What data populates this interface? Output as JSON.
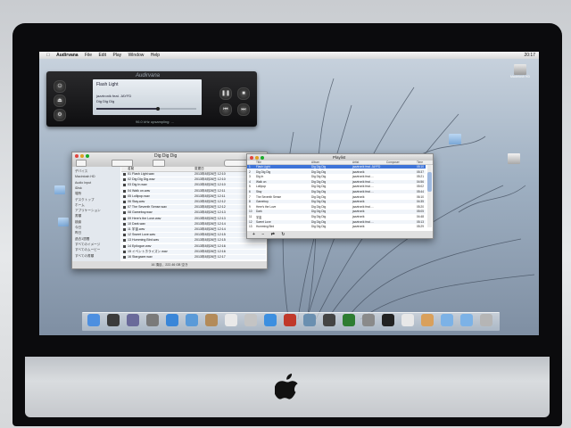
{
  "menubar": {
    "apple": "",
    "app_name": "Audirvana",
    "items": [
      "File",
      "Edit",
      "Play",
      "Window",
      "Help"
    ],
    "clock": "20:17"
  },
  "player": {
    "brand": "Audirvana",
    "track": "Flash Light",
    "artist": "jazztronik feat. JAYFD",
    "album": "Dig Dig Dig",
    "status": "96.0 kHz upsampling: ...",
    "progress": 0.62
  },
  "finder": {
    "title": "Dig Dig Dig",
    "sidebar": [
      {
        "label": "デバイス",
        "head": true
      },
      {
        "label": "Macintosh HD",
        "head": false
      },
      {
        "label": "Audio Input",
        "head": false
      },
      {
        "label": "iDisk",
        "head": false
      },
      {
        "label": "場所",
        "head": true
      },
      {
        "label": "デスクトップ",
        "head": false
      },
      {
        "label": "ホーム",
        "head": false
      },
      {
        "label": "アプリケーション",
        "head": false
      },
      {
        "label": "書類",
        "head": false
      },
      {
        "label": "検索",
        "head": true
      },
      {
        "label": "今日",
        "head": false
      },
      {
        "label": "昨日",
        "head": false
      },
      {
        "label": "過去1週間",
        "head": false
      },
      {
        "label": "すべてのイメージ",
        "head": false
      },
      {
        "label": "すべてのムービー",
        "head": false
      },
      {
        "label": "すべての書類",
        "head": false
      }
    ],
    "columns": [
      "名前",
      "変更日"
    ],
    "rows": [
      {
        "name": "01 Flash Light.wav",
        "date": "2013年8月26日 12:10"
      },
      {
        "name": "02 Dig Dig Dig.wav",
        "date": "2013年8月26日 12:10"
      },
      {
        "name": "03 Dig In.wav",
        "date": "2013年8月26日 12:10"
      },
      {
        "name": "04 Walk on.wav",
        "date": "2013年8月26日 12:11"
      },
      {
        "name": "05 Lollipop.wav",
        "date": "2013年8月26日 12:11"
      },
      {
        "name": "06 Stay.wav",
        "date": "2013年8月26日 12:12"
      },
      {
        "name": "07 The Seventh Sense.wav",
        "date": "2013年8月26日 12:12"
      },
      {
        "name": "08 Gameboy.wav",
        "date": "2013年8月26日 12:13"
      },
      {
        "name": "09 Here's the Love.wav",
        "date": "2013年8月26日 12:13"
      },
      {
        "name": "10 Dark.wav",
        "date": "2013年8月26日 12:14"
      },
      {
        "name": "11 宇宙.wav",
        "date": "2013年8月26日 12:14"
      },
      {
        "name": "12 Sweet Love.wav",
        "date": "2013年8月26日 12:15"
      },
      {
        "name": "13 Humming Bird.wav",
        "date": "2013年8月26日 12:15"
      },
      {
        "name": "14 Epilogue.wav",
        "date": "2013年8月26日 12:16"
      },
      {
        "name": "15 イベントホライズン.wav",
        "date": "2013年8月26日 12:16"
      },
      {
        "name": "16 Stargazer.wav",
        "date": "2013年8月26日 12:17"
      }
    ],
    "status": "16 項目、222.46 GB 空き"
  },
  "playlist": {
    "title": "Playlist",
    "columns": [
      "Title",
      "Album",
      "Artist",
      "Composer",
      "Time"
    ],
    "rows": [
      {
        "title": "Flash Light",
        "album": "Dig Dig Dig",
        "artist": "jazztronik feat. JAYFD",
        "time": "05:10",
        "selected": true
      },
      {
        "title": "Dig Dig Dig",
        "album": "Dig Dig Dig",
        "artist": "jazztronik",
        "time": "05:37",
        "selected": false
      },
      {
        "title": "Dig In",
        "album": "Dig Dig Dig",
        "artist": "jazztronik feat. ...",
        "time": "05:21",
        "selected": false
      },
      {
        "title": "Walk on",
        "album": "Dig Dig Dig",
        "artist": "jazztronik feat. ...",
        "time": "04:56",
        "selected": false
      },
      {
        "title": "Lollipop",
        "album": "Dig Dig Dig",
        "artist": "jazztronik feat. ...",
        "time": "05:02",
        "selected": false
      },
      {
        "title": "Stay",
        "album": "Dig Dig Dig",
        "artist": "jazztronik feat. ...",
        "time": "05:44",
        "selected": false
      },
      {
        "title": "The Seventh Sense",
        "album": "Dig Dig Dig",
        "artist": "jazztronik",
        "time": "06:10",
        "selected": false
      },
      {
        "title": "Gameboy",
        "album": "Dig Dig Dig",
        "artist": "jazztronik",
        "time": "04:35",
        "selected": false
      },
      {
        "title": "Here's the Love",
        "album": "Dig Dig Dig",
        "artist": "jazztronik feat. ...",
        "time": "05:20",
        "selected": false
      },
      {
        "title": "Dark",
        "album": "Dig Dig Dig",
        "artist": "jazztronik",
        "time": "05:05",
        "selected": false
      },
      {
        "title": "宇宙",
        "album": "Dig Dig Dig",
        "artist": "jazztronik",
        "time": "04:48",
        "selected": false
      },
      {
        "title": "Sweet Love",
        "album": "Dig Dig Dig",
        "artist": "jazztronik feat. ...",
        "time": "05:13",
        "selected": false
      },
      {
        "title": "Humming Bird",
        "album": "Dig Dig Dig",
        "artist": "jazztronik",
        "time": "05:29",
        "selected": false
      }
    ]
  },
  "desktop_icons": [
    {
      "label": "Macintosh HD",
      "icon": "hard-drive-icon"
    },
    {
      "label": "",
      "icon": "folder-icon"
    },
    {
      "label": "",
      "icon": "external-drive-icon"
    }
  ],
  "dock_icons": [
    "finder-icon",
    "dashboard-icon",
    "mission-control-icon",
    "launchpad-icon",
    "safari-icon",
    "mail-icon",
    "contacts-icon",
    "ical-icon",
    "preview-icon",
    "itunes-icon",
    "photo-booth-icon",
    "iphoto-icon",
    "garageband-icon",
    "timemachine-icon",
    "system-preferences-icon",
    "dvd-player-icon",
    "audirvana-icon",
    "keyboard-icon",
    "folder-icon",
    "downloads-icon",
    "trash-icon"
  ],
  "colors": {
    "selection": "#3d73d8",
    "player_body": "#1a1a1c",
    "lcd": "#dbe2e9"
  }
}
